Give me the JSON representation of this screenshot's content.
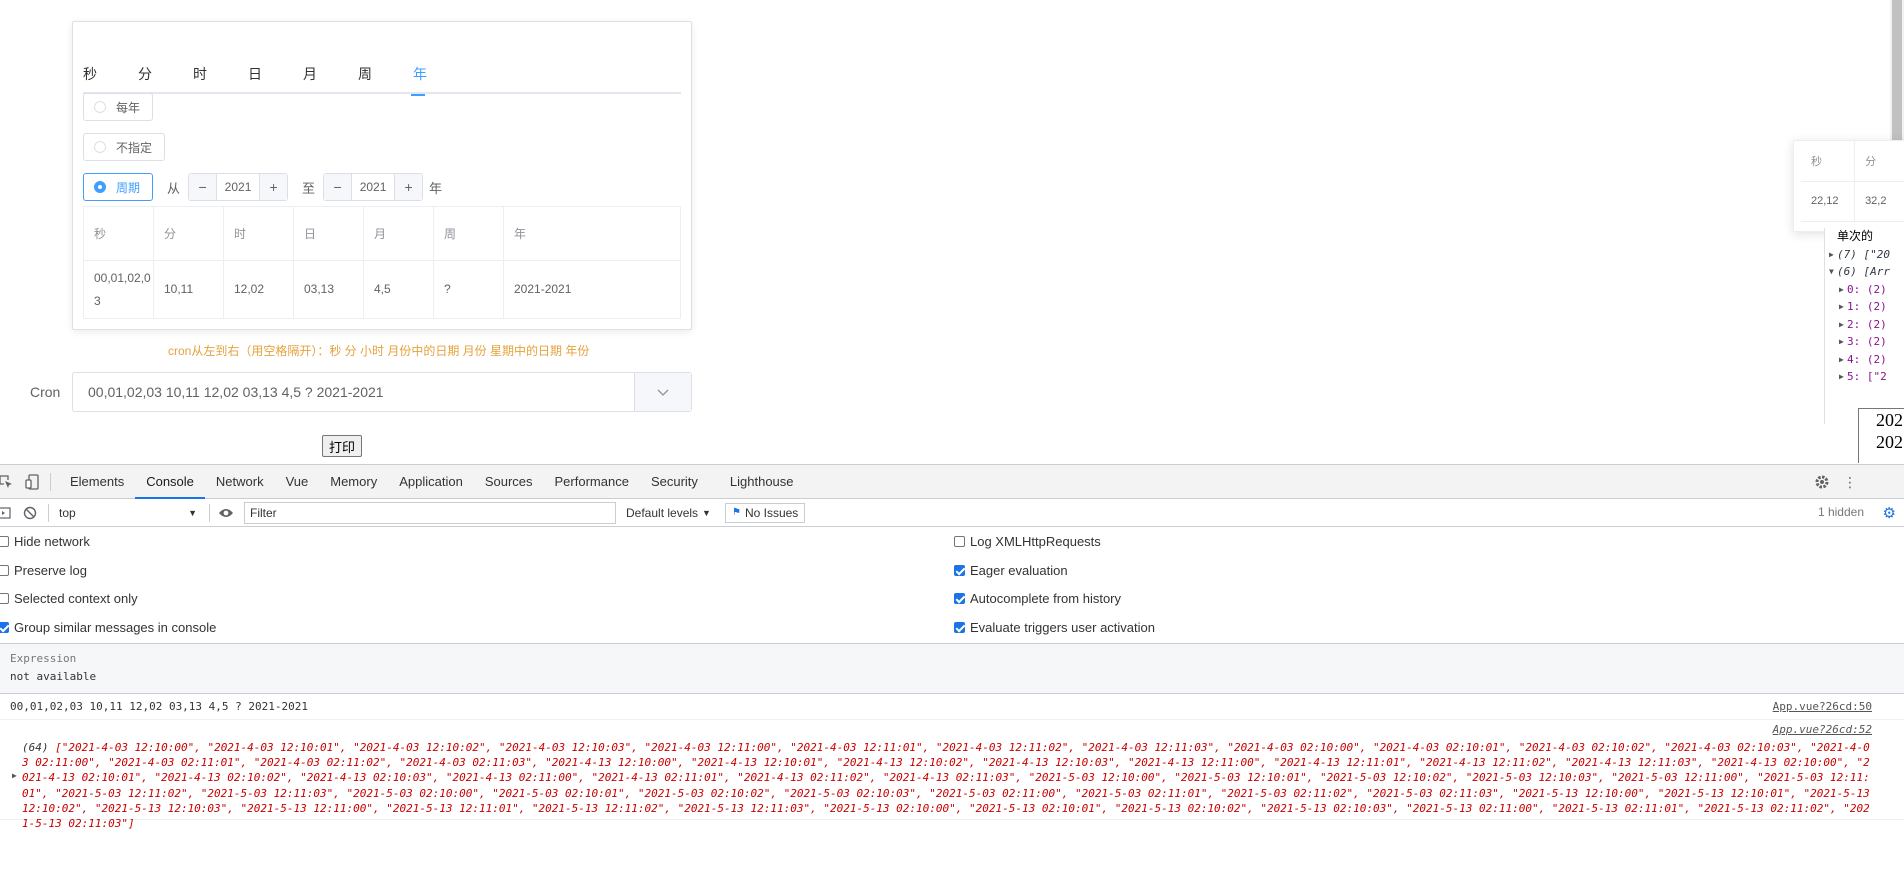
{
  "cron_tabs": [
    "秒",
    "分",
    "时",
    "日",
    "月",
    "周",
    "年"
  ],
  "active_tab_index": 6,
  "radios": {
    "every_year": "每年",
    "not_specified": "不指定",
    "period": "周期",
    "from_label": "从",
    "to_label": "至",
    "year_suffix": "年",
    "from_value": "2021",
    "to_value": "2021"
  },
  "cron_table": {
    "headers": [
      "秒",
      "分",
      "时",
      "日",
      "月",
      "周",
      "年"
    ],
    "row": [
      "00,01,02,03",
      "10,11",
      "12,02",
      "03,13",
      "4,5",
      "?",
      "2021-2021"
    ]
  },
  "hint": "cron从左到右（用空格隔开）：秒 分 小时 月份中的日期 月份 星期中的日期 年份",
  "cron_field": {
    "label": "Cron",
    "value": "00,01,02,03 10,11 12,02 03,13 4,5 ? 2021-2021"
  },
  "print_button": "打印",
  "popup_table": {
    "headers": [
      "秒",
      "分"
    ],
    "row": [
      "22,12",
      "32,2"
    ]
  },
  "side_console": {
    "title": "单次的",
    "lines": [
      {
        "text": "(7) [\"20",
        "kind": "collapsed"
      },
      {
        "text": "(6) [Arr",
        "kind": "expanded"
      },
      {
        "text": "0: (2)",
        "kind": "child"
      },
      {
        "text": "1: (2)",
        "kind": "child"
      },
      {
        "text": "2: (2)",
        "kind": "child"
      },
      {
        "text": "3: (2)",
        "kind": "child"
      },
      {
        "text": "4: (2)",
        "kind": "child"
      },
      {
        "text": "5: [\"2",
        "kind": "child"
      }
    ]
  },
  "mini_dates": [
    "202",
    "202"
  ],
  "devtools": {
    "tabs": [
      "Elements",
      "Console",
      "Network",
      "Vue",
      "Memory",
      "Application",
      "Sources",
      "Performance",
      "Security",
      "Lighthouse"
    ],
    "active_tab": "Console",
    "context": "top",
    "filter_placeholder": "Filter",
    "levels": "Default levels",
    "issues": "No Issues",
    "hidden": "1 hidden",
    "settings_left": [
      {
        "label": "Hide network",
        "checked": false
      },
      {
        "label": "Preserve log",
        "checked": false
      },
      {
        "label": "Selected context only",
        "checked": false
      },
      {
        "label": "Group similar messages in console",
        "checked": true
      }
    ],
    "settings_right": [
      {
        "label": "Log XMLHttpRequests",
        "checked": false
      },
      {
        "label": "Eager evaluation",
        "checked": true
      },
      {
        "label": "Autocomplete from history",
        "checked": true
      },
      {
        "label": "Evaluate triggers user activation",
        "checked": true
      }
    ],
    "expression_label": "Expression",
    "expression_value": "not available",
    "log1": {
      "text": "00,01,02,03 10,11 12,02 03,13 4,5 ? 2021-2021",
      "source": "App.vue?26cd:50"
    },
    "log2": {
      "source": "App.vue?26cd:52",
      "length": "(64)",
      "text": "[\"2021-4-03 12:10:00\", \"2021-4-03 12:10:01\", \"2021-4-03 12:10:02\", \"2021-4-03 12:10:03\", \"2021-4-03 12:11:00\", \"2021-4-03 12:11:01\", \"2021-4-03 12:11:02\", \"2021-4-03 12:11:03\", \"2021-4-03 02:10:00\", \"2021-4-03 02:10:01\", \"2021-4-03 02:10:02\", \"2021-4-03 02:10:03\", \"2021-4-03 02:11:00\", \"2021-4-03 02:11:01\", \"2021-4-03 02:11:02\", \"2021-4-03 02:11:03\", \"2021-4-13 12:10:00\", \"2021-4-13 12:10:01\", \"2021-4-13 12:10:02\", \"2021-4-13 12:10:03\", \"2021-4-13 12:11:00\", \"2021-4-13 12:11:01\", \"2021-4-13 12:11:02\", \"2021-4-13 12:11:03\", \"2021-4-13 02:10:00\", \"2021-4-13 02:10:01\", \"2021-4-13 02:10:02\", \"2021-4-13 02:10:03\", \"2021-4-13 02:11:00\", \"2021-4-13 02:11:01\", \"2021-4-13 02:11:02\", \"2021-4-13 02:11:03\", \"2021-5-03 12:10:00\", \"2021-5-03 12:10:01\", \"2021-5-03 12:10:02\", \"2021-5-03 12:10:03\", \"2021-5-03 12:11:00\", \"2021-5-03 12:11:01\", \"2021-5-03 12:11:02\", \"2021-5-03 12:11:03\", \"2021-5-03 02:10:00\", \"2021-5-03 02:10:01\", \"2021-5-03 02:10:02\", \"2021-5-03 02:10:03\", \"2021-5-03 02:11:00\", \"2021-5-03 02:11:01\", \"2021-5-03 02:11:02\", \"2021-5-03 02:11:03\", \"2021-5-13 12:10:00\", \"2021-5-13 12:10:01\", \"2021-5-13 12:10:02\", \"2021-5-13 12:10:03\", \"2021-5-13 12:11:00\", \"2021-5-13 12:11:01\", \"2021-5-13 12:11:02\", \"2021-5-13 12:11:03\", \"2021-5-13 02:10:00\", \"2021-5-13 02:10:01\", \"2021-5-13 02:10:02\", \"2021-5-13 02:10:03\", \"2021-5-13 02:11:00\", \"2021-5-13 02:11:01\", \"2021-5-13 02:11:02\", \"2021-5-13 02:11:03\"]"
    }
  },
  "colors": {
    "accent": "#409eff",
    "hint": "#e6a23c",
    "console_error_red": "#c80000",
    "devtools_blue": "#1a73e8"
  }
}
